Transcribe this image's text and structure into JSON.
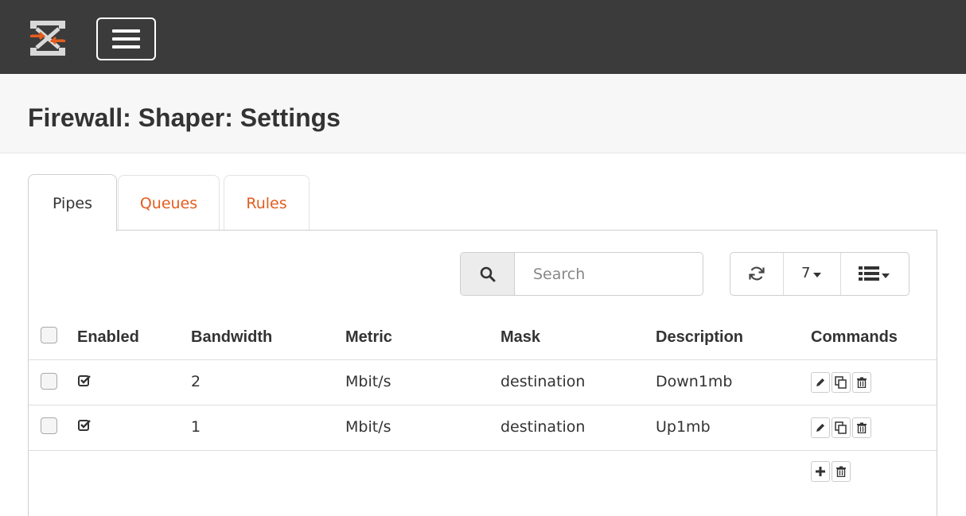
{
  "page": {
    "title": "Firewall: Shaper: Settings"
  },
  "tabs": [
    {
      "label": "Pipes",
      "active": true
    },
    {
      "label": "Queues",
      "active": false
    },
    {
      "label": "Rules",
      "active": false
    }
  ],
  "toolbar": {
    "search_placeholder": "Search",
    "rows_per_page": "7",
    "refresh_icon": "refresh-icon",
    "columns_icon": "list-columns-icon"
  },
  "table": {
    "columns": [
      "Enabled",
      "Bandwidth",
      "Metric",
      "Mask",
      "Description",
      "Commands"
    ],
    "rows": [
      {
        "enabled": true,
        "bandwidth": "2",
        "metric": "Mbit/s",
        "mask": "destination",
        "description": "Down1mb"
      },
      {
        "enabled": true,
        "bandwidth": "1",
        "metric": "Mbit/s",
        "mask": "destination",
        "description": "Up1mb"
      }
    ]
  },
  "colors": {
    "topbar": "#3b3b3b",
    "accent": "#e35d1f",
    "header_bg": "#f7f7f7"
  }
}
